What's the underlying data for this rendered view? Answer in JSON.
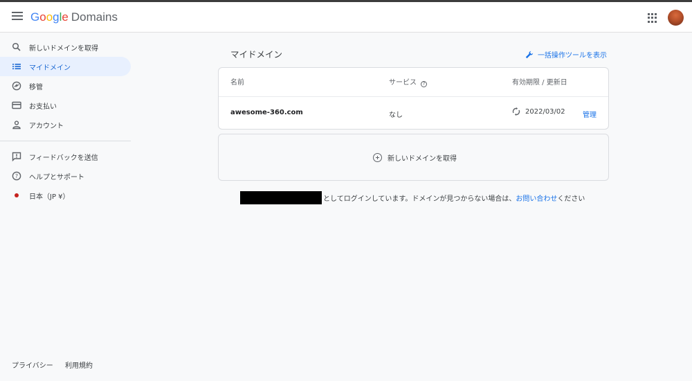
{
  "header": {
    "logo_google": [
      "G",
      "o",
      "o",
      "g",
      "l",
      "e"
    ],
    "logo_product": "Domains"
  },
  "sidebar": {
    "items": [
      {
        "label": "新しいドメインを取得",
        "icon": "search-icon"
      },
      {
        "label": "マイドメイン",
        "icon": "list-icon",
        "active": true
      },
      {
        "label": "移管",
        "icon": "transfer-icon"
      },
      {
        "label": "お支払い",
        "icon": "credit-card-icon"
      },
      {
        "label": "アカウント",
        "icon": "person-icon"
      }
    ],
    "secondary": [
      {
        "label": "フィードバックを送信",
        "icon": "feedback-icon"
      },
      {
        "label": "ヘルプとサポート",
        "icon": "help-icon"
      },
      {
        "label": "日本（JP ¥）",
        "icon": "red-dot-icon"
      }
    ],
    "footer": [
      "プライバシー",
      "利用規約"
    ]
  },
  "main": {
    "title": "マイドメイン",
    "bulk_tool_label": "一括操作ツールを表示",
    "table": {
      "headers": {
        "name": "名前",
        "service": "サービス",
        "expiry": "有効期限 / 更新日"
      },
      "rows": [
        {
          "name": "awesome-360.com",
          "service": "なし",
          "expiry": "2022/03/02",
          "action": "管理"
        }
      ]
    },
    "get_domain_label": "新しいドメインを取得",
    "login_text": "としてログインしています。ドメインが見つからない場合は、",
    "contact_link": "お問い合わせ",
    "login_suffix": "ください"
  },
  "colors": {
    "accent": "#1a73e8",
    "active_bg": "#e8f0fe",
    "region_dot": "#c5221f"
  }
}
